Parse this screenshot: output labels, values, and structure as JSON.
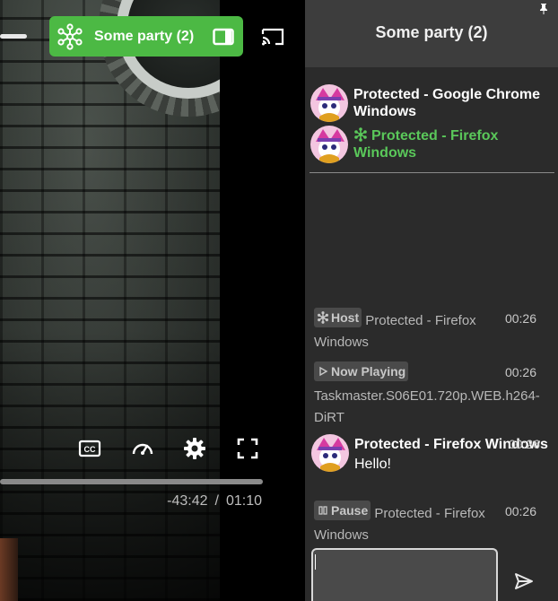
{
  "party": {
    "button_label": "Some party (2)"
  },
  "player": {
    "time_remaining": "-43:42",
    "separator": "/",
    "duration": "01:10",
    "progress_fraction": 0.0
  },
  "sidebar": {
    "title": "Some party (2)",
    "members": [
      {
        "name": "Protected - Google Chrome Windows",
        "is_host": false
      },
      {
        "name": "Protected - Firefox Windows",
        "is_host": true
      }
    ],
    "messages": [
      {
        "tag": "Host",
        "tag_icon": "host-icon",
        "body_line1": "Protected - Firefox",
        "body_line2": "Windows",
        "time": "00:26"
      },
      {
        "tag": "Now Playing",
        "tag_icon": "play-icon",
        "body_line1": "",
        "body_line2": "Taskmaster.S06E01.720p.WEB.h264-",
        "body_line3": "DiRT",
        "time": "00:26"
      },
      {
        "tag": "Pause",
        "tag_icon": "pause-icon",
        "body_line1": "Protected - Firefox",
        "body_line2": "Windows",
        "time": "00:26"
      }
    ],
    "chat": {
      "author": "Protected - Firefox Windows",
      "text": "Hello!",
      "time": "00:26"
    },
    "input_value": ""
  },
  "colors": {
    "accent": "#4cb944",
    "host_name": "#5ac85a",
    "sidebar_bg": "#2b2b2b",
    "header_bg": "#3d3d3d"
  }
}
